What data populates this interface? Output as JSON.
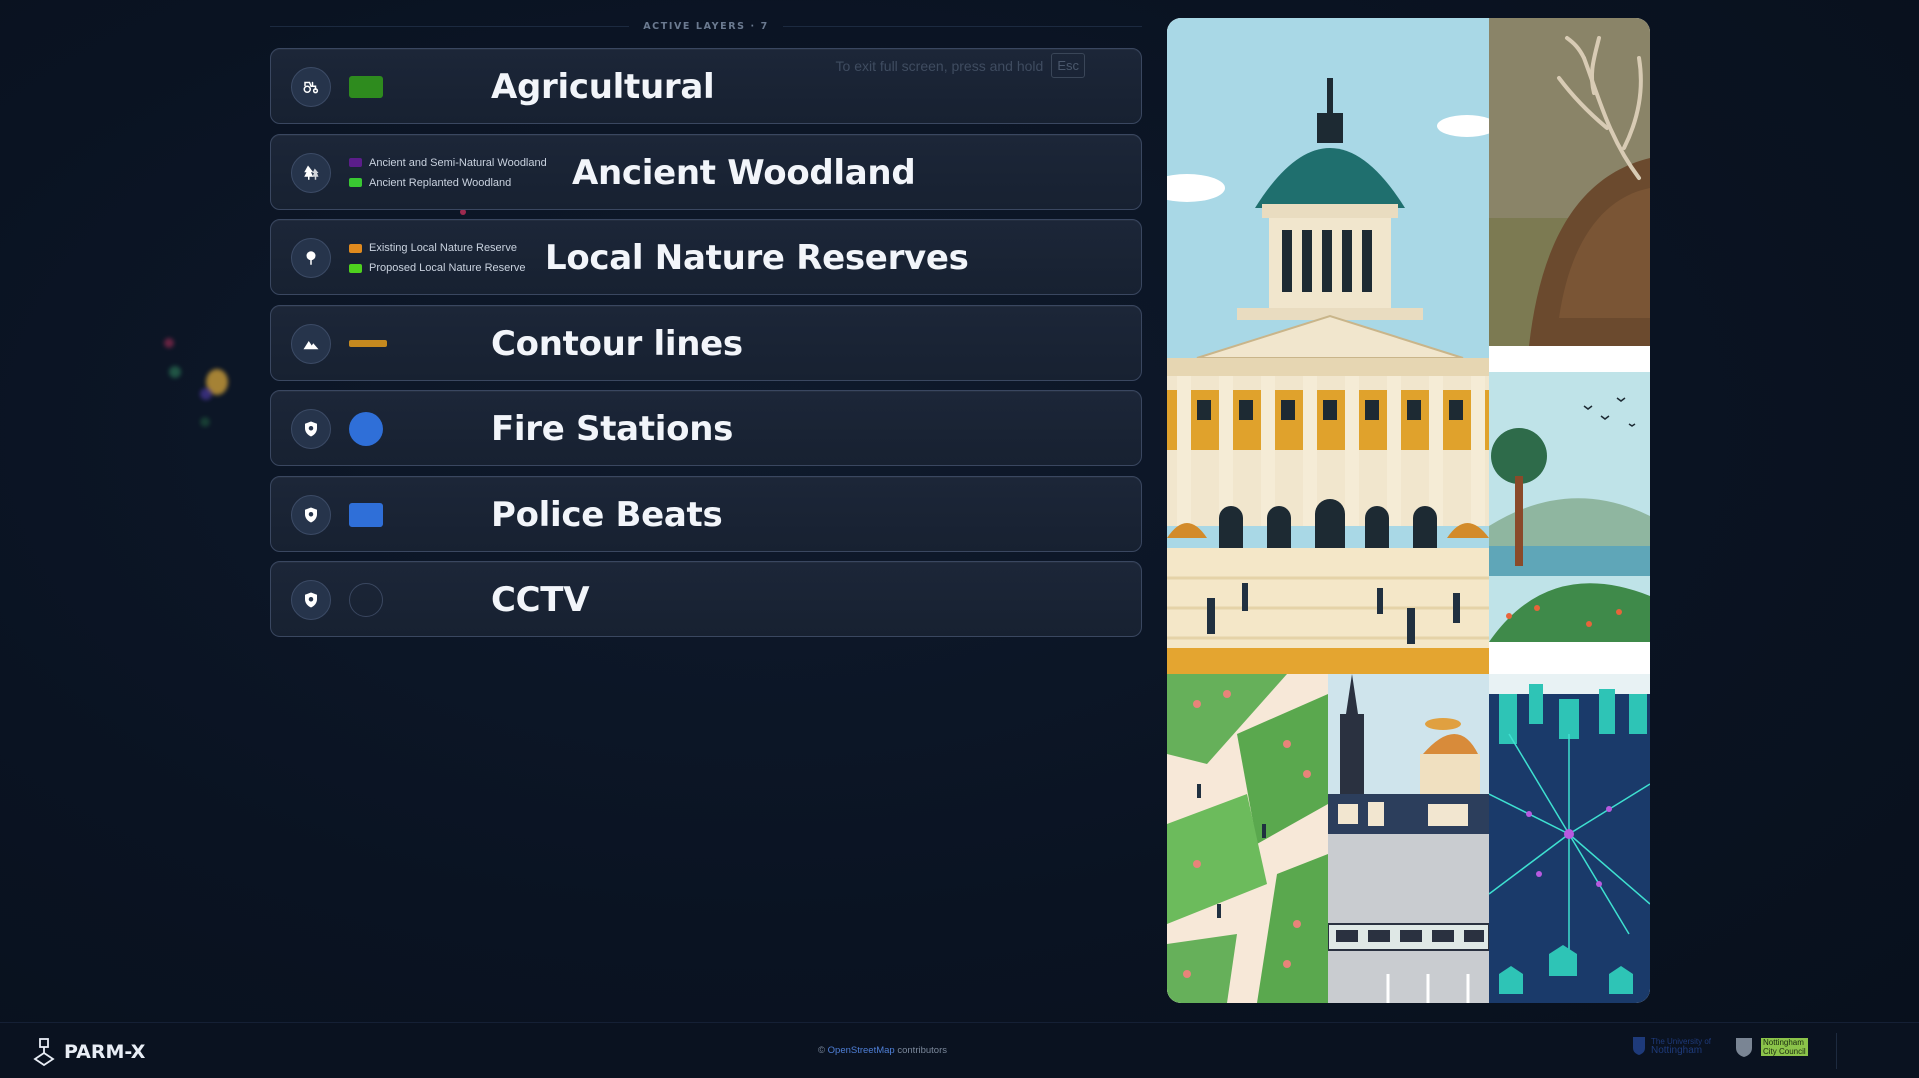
{
  "header": {
    "title": "ACTIVE LAYERS · 7"
  },
  "fullscreen_hint": {
    "text": "To exit full screen, press and hold",
    "key": "Esc"
  },
  "layers": [
    {
      "name": "Agricultural",
      "icon": "tractor-icon",
      "swatch": {
        "type": "rect",
        "color": "#2e8b1e"
      }
    },
    {
      "name": "Ancient Woodland",
      "icon": "trees-icon",
      "legend": [
        {
          "label": "Ancient and Semi-Natural Woodland",
          "color": "#5b1d8a"
        },
        {
          "label": "Ancient Replanted Woodland",
          "color": "#39c832"
        }
      ]
    },
    {
      "name": "Local Nature Reserves",
      "icon": "tree-icon",
      "legend": [
        {
          "label": "Existing Local Nature Reserve",
          "color": "#e08a1e"
        },
        {
          "label": "Proposed Local Nature Reserve",
          "color": "#4ed11e"
        }
      ]
    },
    {
      "name": "Contour lines",
      "icon": "mountain-icon",
      "swatch": {
        "type": "line",
        "color": "#c5891f"
      }
    },
    {
      "name": "Fire Stations",
      "icon": "shield-icon",
      "swatch": {
        "type": "circle",
        "color": "#2f6fd8"
      }
    },
    {
      "name": "Police Beats",
      "icon": "shield-icon",
      "swatch": {
        "type": "rect",
        "color": "#2f6fd8"
      }
    },
    {
      "name": "CCTV",
      "icon": "shield-icon",
      "swatch": {
        "type": "circle-outline",
        "color": "#3a4760"
      }
    }
  ],
  "footer": {
    "brand": "PARM-X",
    "attribution_prefix": "©",
    "attribution_link": "OpenStreetMap",
    "attribution_suffix": "contributors",
    "university": {
      "line1": "The University of",
      "line2": "Nottingham"
    },
    "council": {
      "line1": "Nottingham",
      "line2": "City Council"
    }
  }
}
